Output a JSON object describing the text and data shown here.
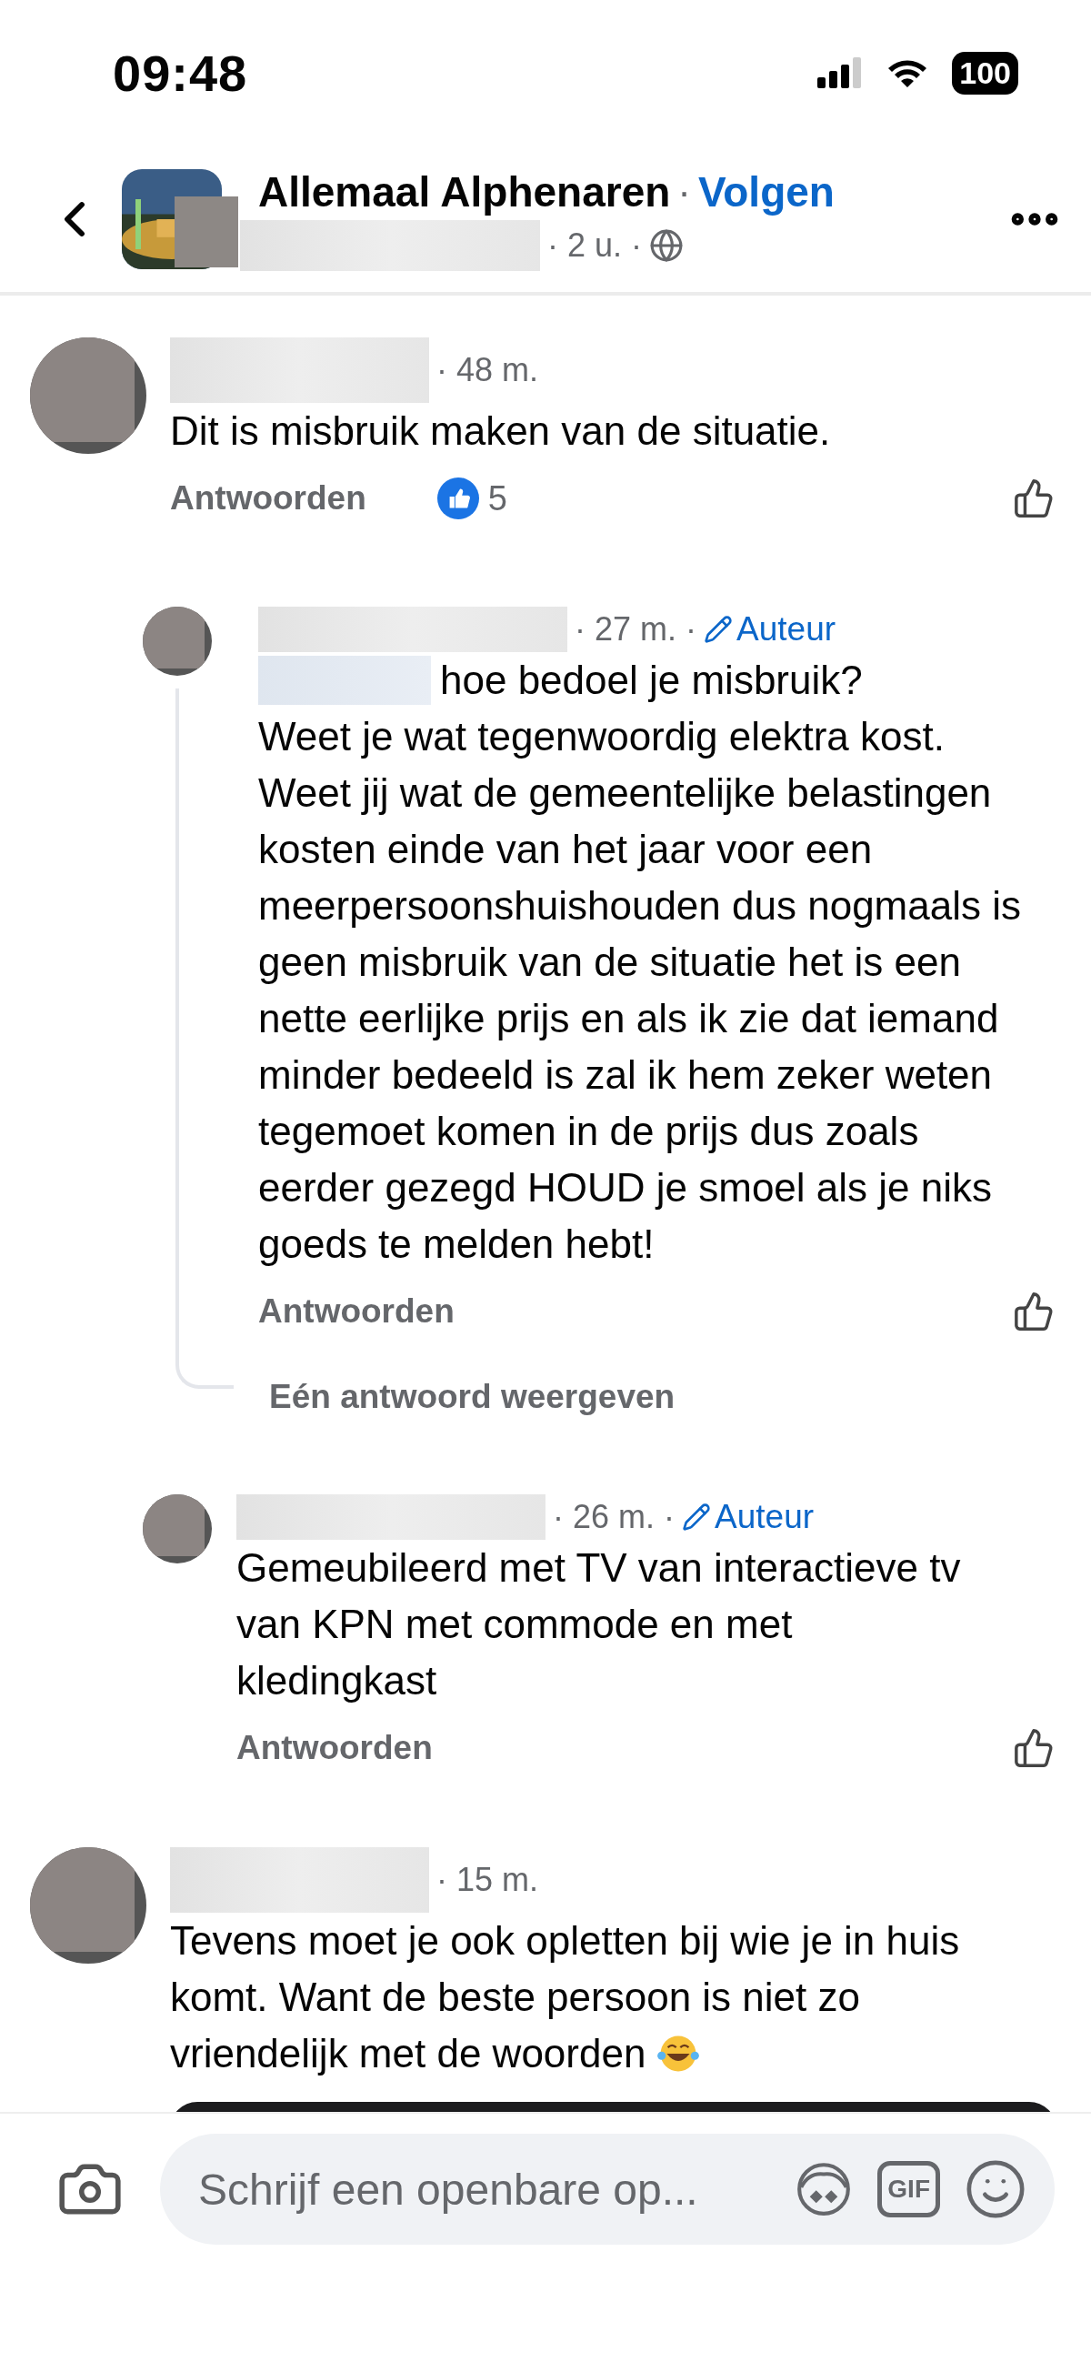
{
  "status_bar": {
    "time": "09:48",
    "battery": "100"
  },
  "header": {
    "group": "Allemaal Alphenaren",
    "separator": "·",
    "follow": "Volgen",
    "time": "· 2 u. ·"
  },
  "comments": [
    {
      "kind": "comment",
      "time": "· 48 m.",
      "text": "Dit is misbruik maken van de situatie.",
      "reply_label": "Antwoorden",
      "reactions": "5",
      "liked": false,
      "replies": [
        {
          "kind": "reply",
          "time": "· 27 m. ·",
          "badge": "Auteur",
          "mention_line": "hoe bedoel je misbruik?",
          "text": "Weet je wat tegenwoordig elektra kost.\nWeet jij wat de gemeentelijke belastingen\nkosten einde van het jaar voor een\nmeerpersoonshuishouden dus nogmaals is\ngeen misbruik van de situatie het is een\nnette eerlijke prijs en als ik zie dat iemand\nminder bedeeld is zal ik hem zeker weten\ntegemoet komen in de prijs dus zoals\neerder gezegd HOUD je smoel als je niks\ngoeds te melden hebt!",
          "reply_label": "Antwoorden",
          "liked": false,
          "more_replies": "Eén antwoord weergeven"
        },
        {
          "kind": "reply",
          "time": "· 26 m. ·",
          "badge": "Auteur",
          "text": "Gemeubileerd met TV van interactieve tv\nvan KPN met commode en met\nkledingkast",
          "reply_label": "Antwoorden",
          "liked": false
        }
      ]
    },
    {
      "kind": "comment",
      "time": "· 15 m.",
      "text": "Tevens moet je ook opletten bij wie je in huis\nkomt. Want de beste persoon is niet zo\nvriendelijk met de woorden",
      "emoji": true
    }
  ],
  "composer": {
    "placeholder": "Schrijf een openbare op...",
    "gif_label": "GIF"
  }
}
